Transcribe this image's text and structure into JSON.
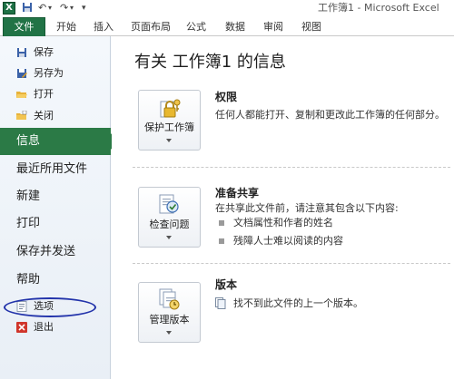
{
  "titlebar": {
    "app_icon": "excel-icon",
    "window_title": "工作簿1 - Microsoft Excel",
    "quick_access": [
      "save-icon",
      "undo-icon",
      "redo-icon",
      "customize-dropdown-icon"
    ]
  },
  "ribbon": {
    "file_tab": "文件",
    "tabs": [
      "开始",
      "插入",
      "页面布局",
      "公式",
      "数据",
      "审阅",
      "视图"
    ]
  },
  "nav": {
    "small_items": [
      {
        "label": "保存",
        "icon": "save-icon"
      },
      {
        "label": "另存为",
        "icon": "save-as-icon"
      },
      {
        "label": "打开",
        "icon": "folder-open-icon"
      },
      {
        "label": "关闭",
        "icon": "folder-close-icon"
      }
    ],
    "big_items": [
      "信息",
      "最近所用文件",
      "新建",
      "打印",
      "保存并发送",
      "帮助"
    ],
    "bottom_items": [
      {
        "label": "选项",
        "icon": "options-icon"
      },
      {
        "label": "退出",
        "icon": "exit-icon"
      }
    ],
    "selected": "信息"
  },
  "main": {
    "title": "有关 工作簿1 的信息",
    "sections": [
      {
        "button_label": "保护工作簿",
        "button_icon": "lock-key-icon",
        "title": "权限",
        "text": "任何人都能打开、复制和更改此工作簿的任何部分。"
      },
      {
        "button_label": "检查问题",
        "button_icon": "inspect-document-icon",
        "title": "准备共享",
        "text": "在共享此文件前，请注意其包含以下内容:",
        "bullets": [
          "文档属性和作者的姓名",
          "残障人士难以阅读的内容"
        ]
      },
      {
        "button_label": "管理版本",
        "button_icon": "manage-versions-icon",
        "title": "版本",
        "text": "找不到此文件的上一个版本。"
      }
    ]
  },
  "colors": {
    "accent_green": "#2b7a46",
    "annotation_blue": "#2233aa"
  }
}
